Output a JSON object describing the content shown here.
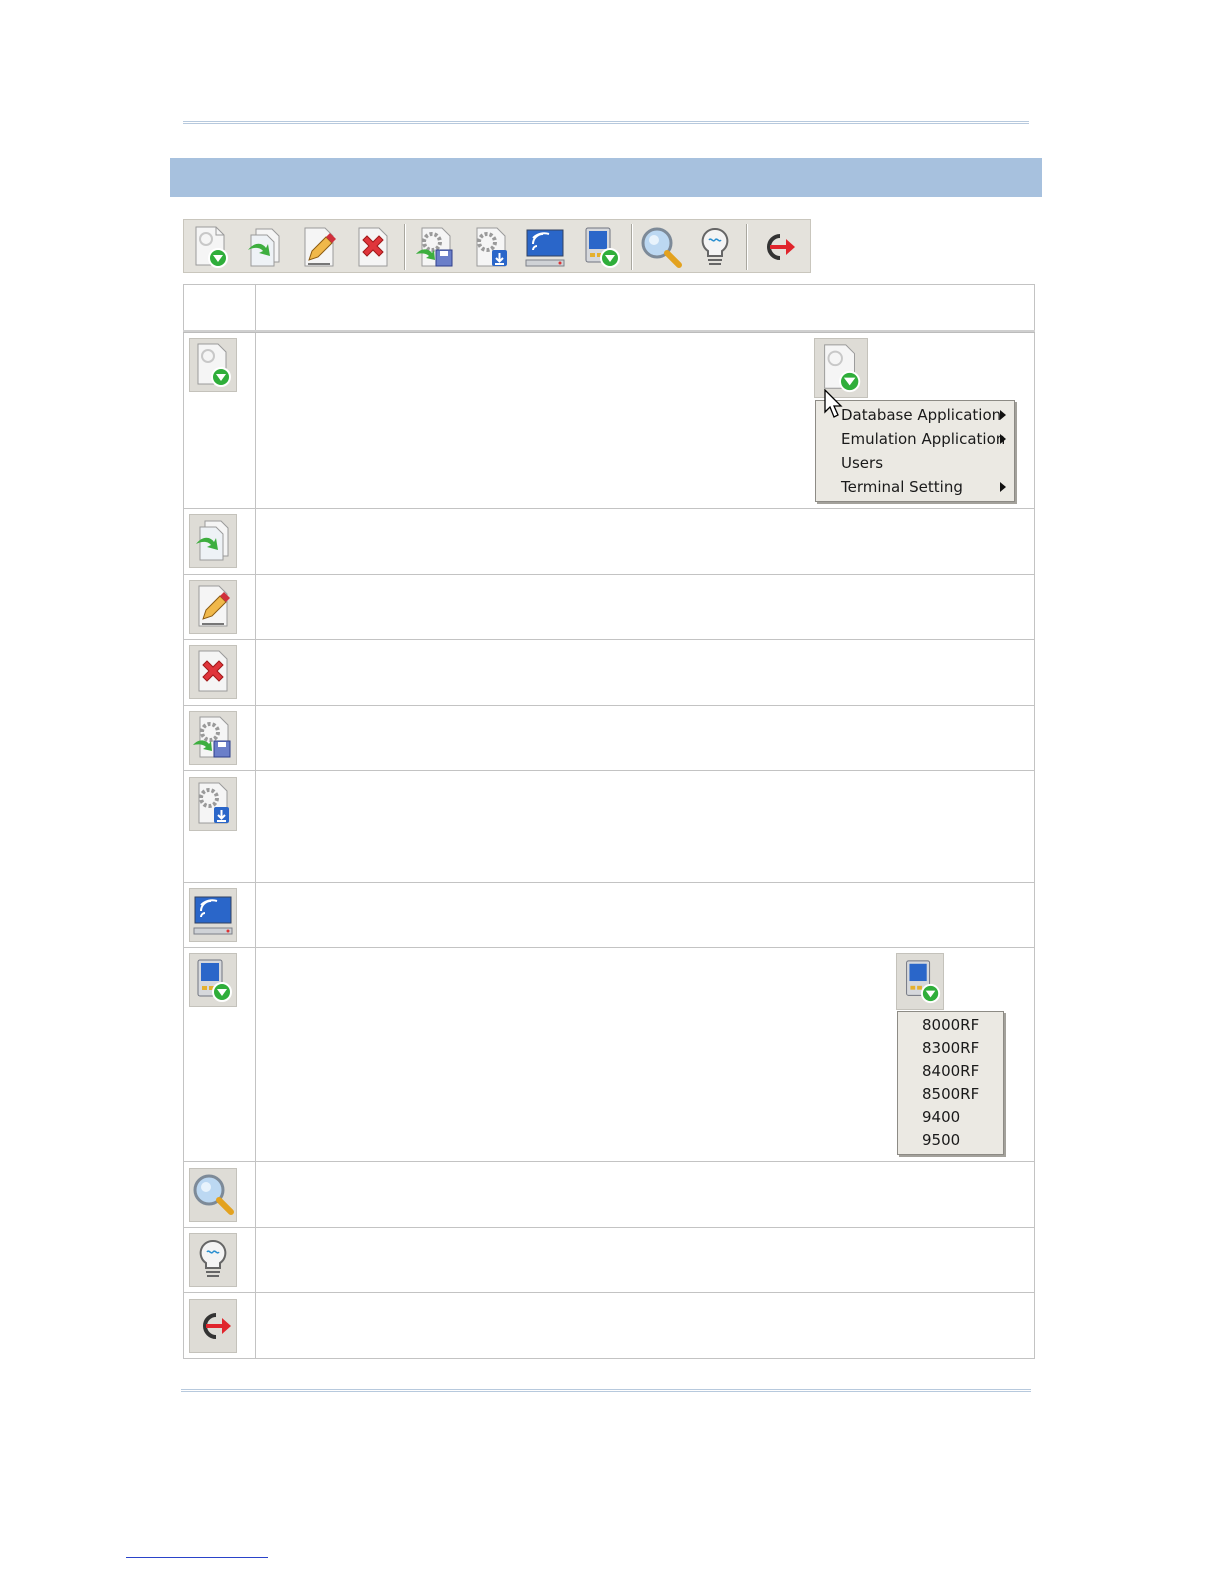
{
  "toolbar": {
    "buttons": [
      {
        "name": "new-icon"
      },
      {
        "name": "copy-icon"
      },
      {
        "name": "edit-icon"
      },
      {
        "name": "delete-icon"
      },
      {
        "name": "save-settings-icon"
      },
      {
        "name": "download-settings-icon"
      },
      {
        "name": "connect-terminal-icon"
      },
      {
        "name": "simulator-icon"
      },
      {
        "name": "search-icon"
      },
      {
        "name": "help-tips-icon"
      },
      {
        "name": "exit-icon"
      }
    ]
  },
  "new_menu": {
    "items": [
      {
        "label": "Database Application",
        "submenu": true
      },
      {
        "label": "Emulation Application",
        "submenu": true
      },
      {
        "label": "Users",
        "submenu": false
      },
      {
        "label": "Terminal Setting",
        "submenu": true
      }
    ]
  },
  "simulator_menu": {
    "items": [
      {
        "label": "8000RF"
      },
      {
        "label": "8300RF"
      },
      {
        "label": "8400RF"
      },
      {
        "label": "8500RF"
      },
      {
        "label": "9400"
      },
      {
        "label": "9500"
      }
    ]
  },
  "colors": {
    "section_bar": "#a7c1de",
    "green_badge": "#2fae3a",
    "red_x": "#e0353b",
    "blue_screen": "#2a66c9"
  }
}
